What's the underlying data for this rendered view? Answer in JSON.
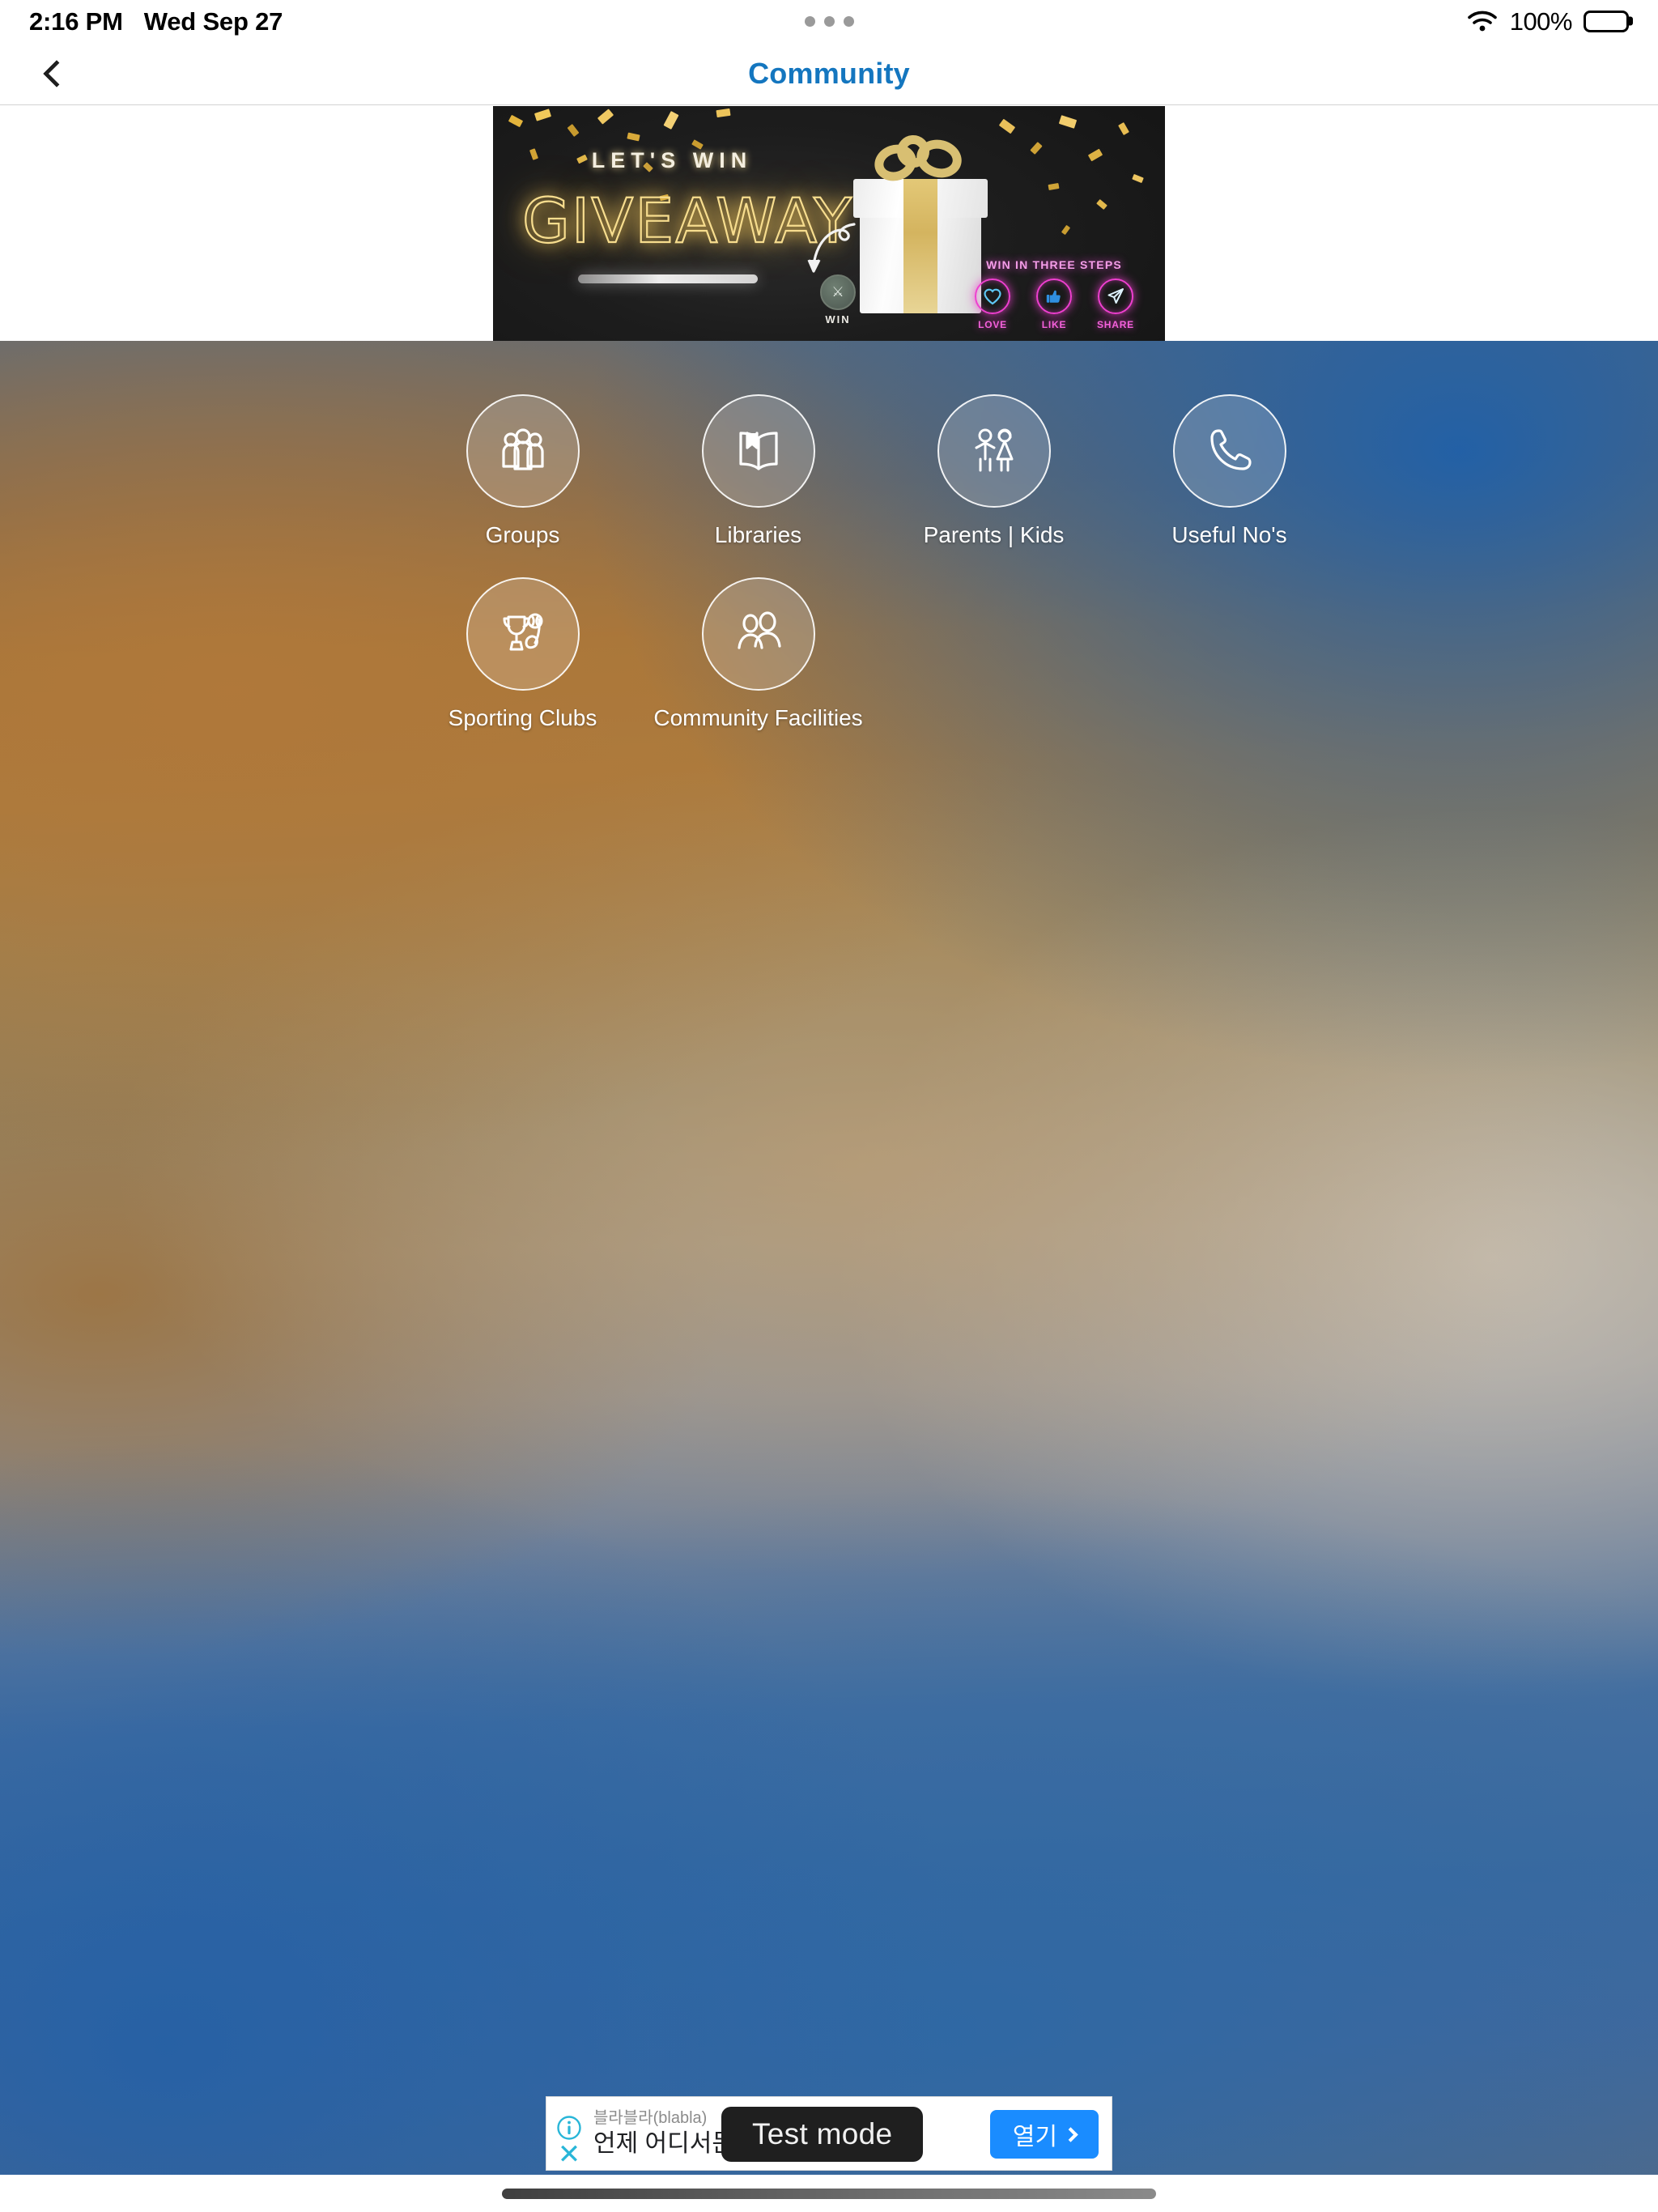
{
  "status_bar": {
    "time": "2:16 PM",
    "date": "Wed Sep 27",
    "battery_percent": "100%",
    "wifi_icon": "wifi-icon",
    "battery_icon": "battery-full-icon",
    "dots_icon": "three-dots-icon"
  },
  "nav": {
    "back_icon": "chevron-left-icon",
    "title": "Community"
  },
  "promo_banner": {
    "kicker": "LET'S WIN",
    "headline": "GIVEAWAY",
    "win_label": "WIN",
    "win_icon": "trophy-badge-icon",
    "arrow_icon": "curved-arrow-icon",
    "gift_icon": "gift-box-icon",
    "steps_title": "WIN IN THREE STEPS",
    "steps": [
      {
        "label": "LOVE",
        "icon": "heart-icon"
      },
      {
        "label": "LIKE",
        "icon": "thumbs-up-icon"
      },
      {
        "label": "SHARE",
        "icon": "paper-plane-icon"
      }
    ],
    "accent_neon_gold": "#f7dd8e",
    "accent_neon_pink": "#ef3fd0"
  },
  "grid": {
    "rows": [
      [
        {
          "label": "Groups",
          "icon": "people-group-icon"
        },
        {
          "label": "Libraries",
          "icon": "open-book-icon"
        },
        {
          "label": "Parents | Kids",
          "icon": "boy-girl-icon"
        },
        {
          "label": "Useful No's",
          "icon": "phone-handset-icon"
        }
      ],
      [
        {
          "label": "Sporting Clubs",
          "icon": "trophy-golf-icon"
        },
        {
          "label": "Community Facilities",
          "icon": "two-people-icon"
        }
      ]
    ]
  },
  "ad": {
    "info_icon": "info-circle-icon",
    "close_icon": "close-x-icon",
    "advertiser": "블라블라(blabla)",
    "headline": "언제 어디서든 앱",
    "test_mode_label": "Test mode",
    "cta_label": "열기",
    "cta_icon": "chevron-right-icon",
    "cta_color": "#1a8cff"
  },
  "home_indicator": {
    "icon": "home-indicator-bar"
  }
}
